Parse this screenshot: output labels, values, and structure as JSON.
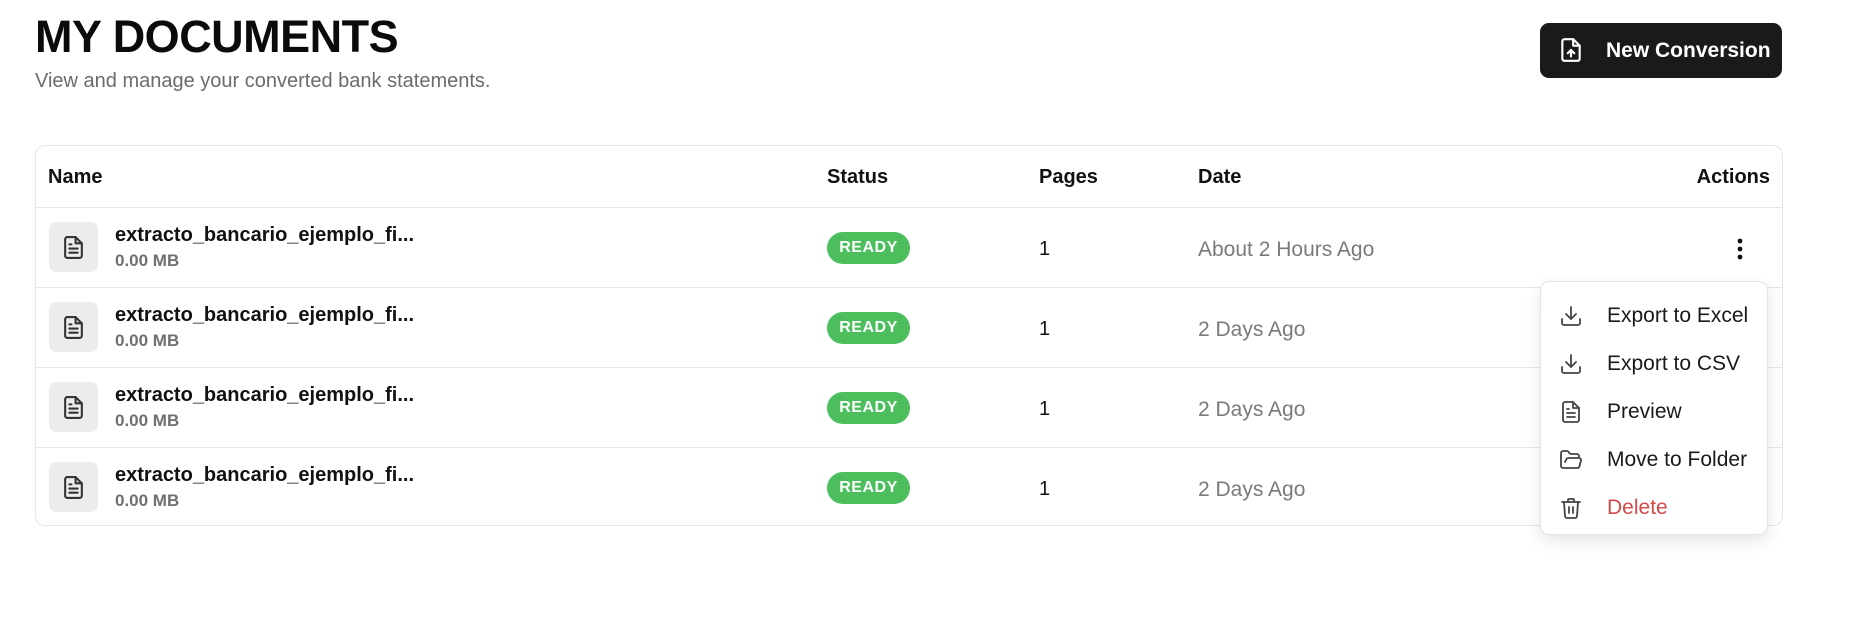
{
  "header": {
    "title": "MY DOCUMENTS",
    "subtitle": "View and manage your converted bank statements.",
    "new_button_label": "New Conversion",
    "new_button_icon": "file-upload-icon"
  },
  "table": {
    "columns": {
      "name": "Name",
      "status": "Status",
      "pages": "Pages",
      "date": "Date",
      "actions": "Actions"
    },
    "rows": [
      {
        "name": "extracto_bancario_ejemplo_fi...",
        "size": "0.00 MB",
        "status": "READY",
        "pages": "1",
        "date": "About 2 Hours Ago"
      },
      {
        "name": "extracto_bancario_ejemplo_fi...",
        "size": "0.00 MB",
        "status": "READY",
        "pages": "1",
        "date": "2 Days Ago"
      },
      {
        "name": "extracto_bancario_ejemplo_fi...",
        "size": "0.00 MB",
        "status": "READY",
        "pages": "1",
        "date": "2 Days Ago"
      },
      {
        "name": "extracto_bancario_ejemplo_fi...",
        "size": "0.00 MB",
        "status": "READY",
        "pages": "1",
        "date": "2 Days Ago"
      }
    ]
  },
  "actions_menu": {
    "items": [
      {
        "label": "Export to Excel",
        "icon": "download-icon"
      },
      {
        "label": "Export to CSV",
        "icon": "download-icon"
      },
      {
        "label": "Preview",
        "icon": "file-text-icon"
      },
      {
        "label": "Move to Folder",
        "icon": "folder-open-icon"
      },
      {
        "label": "Delete",
        "icon": "trash-icon"
      }
    ]
  },
  "colors": {
    "primary_button": "#1a1a1a",
    "status_ready": "#4cbf5c",
    "danger": "#d24a4a"
  }
}
